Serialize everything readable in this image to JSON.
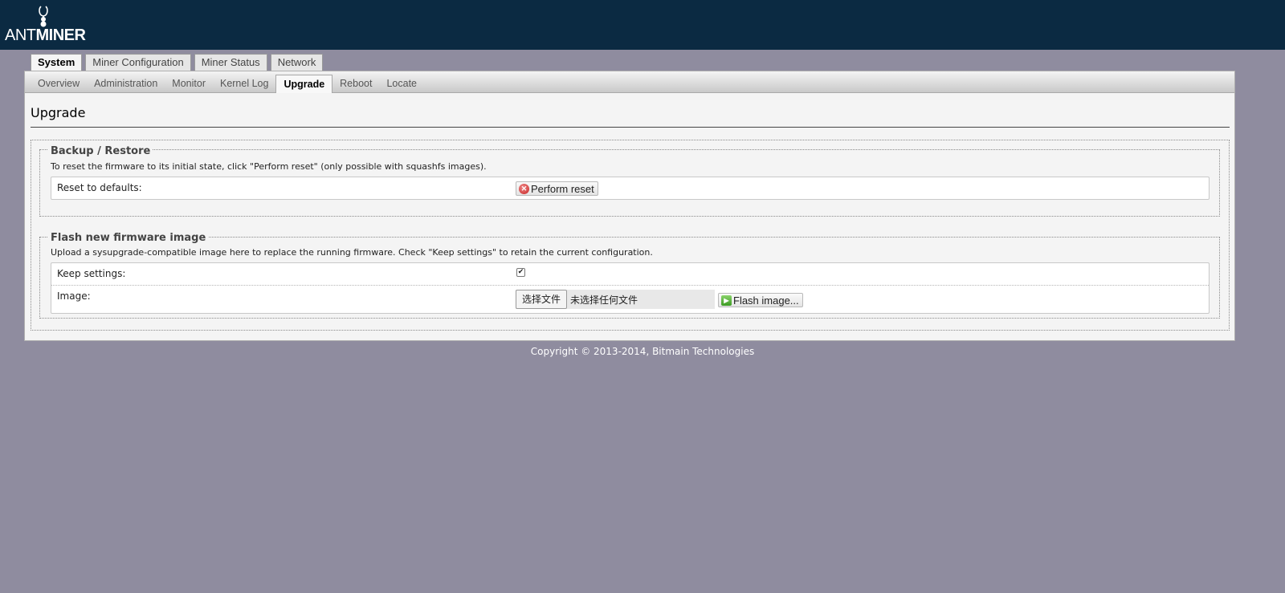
{
  "header": {
    "logo_light": "ANT",
    "logo_bold": "MINER",
    "logo_icon": "ant-icon",
    "bg_color": "#0b2a42"
  },
  "main_tabs": [
    {
      "label": "System",
      "active": true
    },
    {
      "label": "Miner Configuration",
      "active": false
    },
    {
      "label": "Miner Status",
      "active": false
    },
    {
      "label": "Network",
      "active": false
    }
  ],
  "sub_tabs": [
    {
      "label": "Overview",
      "active": false
    },
    {
      "label": "Administration",
      "active": false
    },
    {
      "label": "Monitor",
      "active": false
    },
    {
      "label": "Kernel Log",
      "active": false
    },
    {
      "label": "Upgrade",
      "active": true
    },
    {
      "label": "Reboot",
      "active": false
    },
    {
      "label": "Locate",
      "active": false
    }
  ],
  "page": {
    "title": "Upgrade"
  },
  "backup": {
    "legend": "Backup / Restore",
    "description": "To reset the firmware to its initial state, click \"Perform reset\" (only possible with squashfs images).",
    "reset_label": "Reset to defaults:",
    "reset_button": "Perform reset",
    "reset_icon": "reset-icon"
  },
  "flash": {
    "legend": "Flash new firmware image",
    "description": "Upload a sysupgrade-compatible image here to replace the running firmware. Check \"Keep settings\" to retain the current configuration.",
    "keep_label": "Keep settings:",
    "keep_checked": true,
    "image_label": "Image:",
    "file_button": "选择文件",
    "file_status": "未选择任何文件",
    "flash_button": "Flash image...",
    "flash_icon": "flash-icon"
  },
  "footer": {
    "copyright": "Copyright © 2013-2014, Bitmain Technologies"
  },
  "colors": {
    "page_bg": "#8f8c9f",
    "panel_bg": "#f4f4f4"
  }
}
